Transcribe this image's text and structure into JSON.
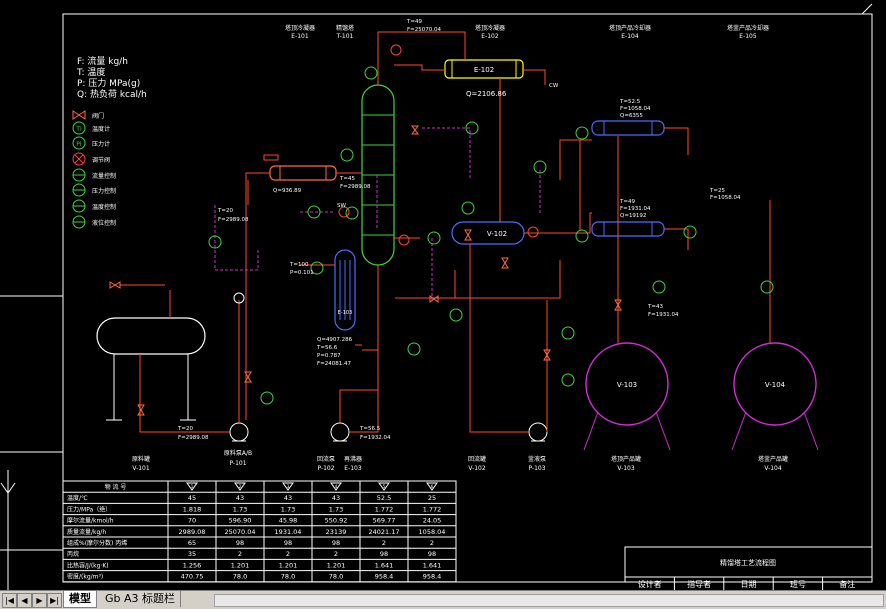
{
  "legend_units": {
    "flow": "F: 流量 kg/h",
    "temp": "T: 温度",
    "pressure": "P: 压力 MPa(g)",
    "heat": "Q: 热负荷 kcal/h"
  },
  "symbol_legend": [
    {
      "label": "阀门",
      "icon": "valve-icon"
    },
    {
      "label": "温度计",
      "icon": "temperature-indicator-icon"
    },
    {
      "label": "压力计",
      "icon": "pressure-indicator-icon"
    },
    {
      "label": "调节阀",
      "icon": "control-valve-icon"
    },
    {
      "label": "流量控制",
      "icon": "flow-controller-icon"
    },
    {
      "label": "压力控制",
      "icon": "pressure-controller-icon"
    },
    {
      "label": "温度控制",
      "icon": "temperature-controller-icon"
    },
    {
      "label": "液位控制",
      "icon": "level-controller-icon"
    }
  ],
  "top_labels": [
    {
      "name": "塔顶冷凝器",
      "tag": "E-101"
    },
    {
      "name": "精馏塔",
      "tag": "T-101"
    },
    {
      "name": "塔顶冷凝器",
      "tag": "E-102"
    },
    {
      "name": "塔顶产品冷却器",
      "tag": "E-104"
    },
    {
      "name": "塔釜产品冷却器",
      "tag": "E-105"
    }
  ],
  "stream_annotations": {
    "top_feed": {
      "t": "T=49",
      "f": "F=25070.04"
    },
    "condenser_q": "Q=2106.86",
    "cw": "CW",
    "reboiler_q": "Q=936.89",
    "feed_preheat": {
      "t": "T=45",
      "f": "F=2989.08"
    },
    "feed_left": {
      "t": "T=20",
      "f": "F=2989.08"
    },
    "steam": {
      "t": "T=100",
      "p": "P=0.101"
    },
    "sw": "SW",
    "e104": {
      "t": "T=52.5",
      "f": "F=1058.04",
      "q": "Q=6355"
    },
    "e105_in": {
      "t": "T=49",
      "f": "F=1931.04",
      "q": "Q=19192"
    },
    "e105_out": {
      "t": "T=25",
      "f": "F=1058.04"
    },
    "v103_in": {
      "t": "T=43",
      "f": "F=1931.04"
    },
    "e103": {
      "q": "Q=4907.286",
      "t": "T=56.6",
      "p": "P=0.787",
      "f": "F=24081.47"
    },
    "p101_feed": {
      "t": "T=20",
      "f": "F=2989.08"
    },
    "p102": {
      "t": "T=56.5",
      "f": "F=1932.04"
    }
  },
  "equipment": {
    "e102_box": "E-102",
    "v102_drum": "V-102",
    "e103_box": "E-103",
    "v103_sphere": "V-103",
    "v104_sphere": "V-104"
  },
  "bottom_labels": [
    {
      "name": "原料罐",
      "tag": "V-101"
    },
    {
      "name": "原料泵A/B",
      "tag": "P-101"
    },
    {
      "name": "回流泵",
      "tag": "P-102"
    },
    {
      "name": "再沸器",
      "tag": "E-103"
    },
    {
      "name": "回流罐",
      "tag": "V-102"
    },
    {
      "name": "釜液泵",
      "tag": "P-103"
    },
    {
      "name": "塔顶产品罐",
      "tag": "V-103"
    },
    {
      "name": "塔釜产品罐",
      "tag": "V-104"
    }
  ],
  "stream_table": {
    "header_label": "物 流 号",
    "stream_ids": [
      "1",
      "2",
      "3",
      "4",
      "5",
      "6"
    ],
    "rows": [
      {
        "label": "温度/℃",
        "values": [
          "45",
          "43",
          "43",
          "43",
          "52.5",
          "25"
        ]
      },
      {
        "label": "压力/MPa（绝）",
        "values": [
          "1.818",
          "1.73",
          "1.73",
          "1.73",
          "1.772",
          "1.772"
        ]
      },
      {
        "label": "摩尔流量/kmol/h",
        "values": [
          "70",
          "596.90",
          "45.98",
          "550.92",
          "569.77",
          "24.05"
        ]
      },
      {
        "label": "质量流量/kg/h",
        "values": [
          "2989.08",
          "25070.04",
          "1931.04",
          "23139",
          "24021.17",
          "1058.04"
        ]
      },
      {
        "label": "组成%(摩尔分数)",
        "sub": "丙烯",
        "values": [
          "65",
          "98",
          "98",
          "98",
          "2",
          "2"
        ]
      },
      {
        "label": "",
        "sub": "丙烷",
        "values": [
          "35",
          "2",
          "2",
          "2",
          "98",
          "98"
        ]
      },
      {
        "label": "比热容/J/(kg·K)",
        "values": [
          "1.256",
          "1.201",
          "1.201",
          "1.201",
          "1.641",
          "1.641"
        ]
      },
      {
        "label": "密度/(kg/m³)",
        "values": [
          "470.75",
          "78.0",
          "78.0",
          "78.0",
          "958.4",
          "958.4"
        ]
      }
    ]
  },
  "title_block": {
    "title": "精馏塔工艺流程图",
    "cols": [
      "设计者",
      "指导者",
      "日期",
      "班号",
      "备注"
    ]
  },
  "tabs": [
    "模型",
    "Gb A3 标题栏"
  ]
}
